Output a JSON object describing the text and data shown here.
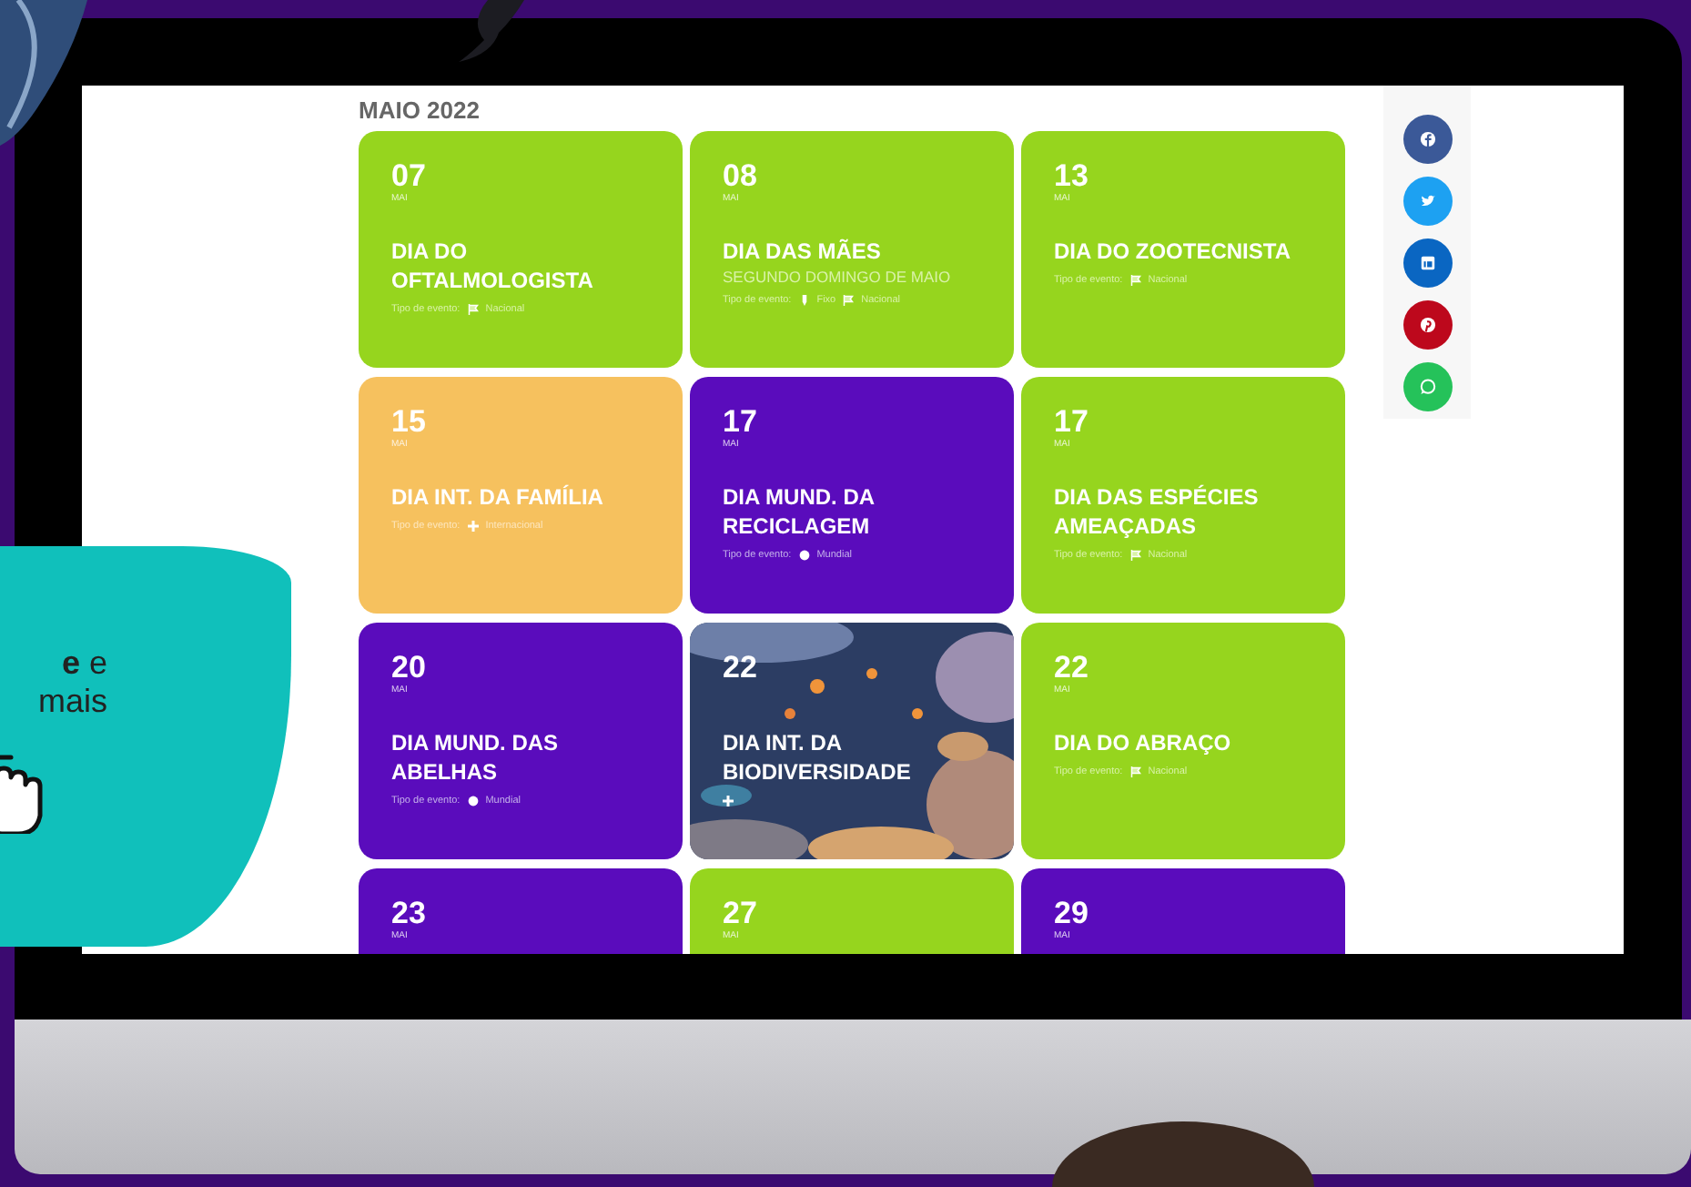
{
  "callout": {
    "lines": [
      "**e** e",
      "mais"
    ]
  },
  "page": {
    "heading": "MAIO 2022",
    "events": [
      {
        "kind": "color",
        "color": "#96d51e",
        "day": "07",
        "month": "MAI",
        "title": "DIA DO OFTALMOLOGISTA",
        "meta_label": "Tipo de evento:",
        "tags": [
          {
            "kind": "nacional",
            "label": "Nacional"
          }
        ]
      },
      {
        "kind": "color",
        "color": "#96d51e",
        "day": "08",
        "month": "MAI",
        "title": "DIA DAS MÃES",
        "subtitle": "SEGUNDO DOMINGO DE MAIO",
        "meta_label": "Tipo de evento:",
        "tags": [
          {
            "kind": "fixo",
            "label": "Fixo"
          },
          {
            "kind": "nacional",
            "label": "Nacional"
          }
        ]
      },
      {
        "kind": "color",
        "color": "#96d51e",
        "day": "13",
        "month": "MAI",
        "title": "DIA DO ZOOTECNISTA",
        "meta_label": "Tipo de evento:",
        "tags": [
          {
            "kind": "nacional",
            "label": "Nacional"
          }
        ]
      },
      {
        "kind": "color",
        "color": "#f6c15e",
        "day": "15",
        "month": "MAI",
        "title": "DIA INT. DA FAMÍLIA",
        "meta_label": "Tipo de evento:",
        "tags": [
          {
            "kind": "internacional",
            "label": "Internacional"
          }
        ]
      },
      {
        "kind": "color",
        "color": "#5a0cbc",
        "day": "17",
        "month": "MAI",
        "title": "DIA MUND. DA RECICLAGEM",
        "meta_label": "Tipo de evento:",
        "tags": [
          {
            "kind": "mundial",
            "label": "Mundial"
          }
        ]
      },
      {
        "kind": "color",
        "color": "#96d51e",
        "day": "17",
        "month": "MAI",
        "title": "DIA DAS ESPÉCIES AMEAÇADAS",
        "meta_label": "Tipo de evento:",
        "tags": [
          {
            "kind": "nacional",
            "label": "Nacional"
          }
        ]
      },
      {
        "kind": "color",
        "color": "#5a0cbc",
        "day": "20",
        "month": "MAI",
        "title": "DIA MUND. DAS ABELHAS",
        "meta_label": "Tipo de evento:",
        "tags": [
          {
            "kind": "mundial",
            "label": "Mundial"
          }
        ]
      },
      {
        "kind": "picture",
        "day": "22",
        "title": "DIA INT. DA BIODIVERSIDADE",
        "tags": [
          {
            "kind": "internacional"
          }
        ]
      },
      {
        "kind": "color",
        "color": "#96d51e",
        "day": "22",
        "month": "MAI",
        "title": "DIA DO ABRAÇO",
        "meta_label": "Tipo de evento:",
        "tags": [
          {
            "kind": "nacional",
            "label": "Nacional"
          }
        ]
      },
      {
        "kind": "color",
        "color": "#5a0cbc",
        "day": "23",
        "month": "MAI"
      },
      {
        "kind": "color",
        "color": "#96d51e",
        "day": "27",
        "month": "MAI"
      },
      {
        "kind": "color",
        "color": "#5a0cbc",
        "day": "29",
        "month": "MAI"
      }
    ],
    "share": [
      {
        "kind": "facebook",
        "color": "#3b5998"
      },
      {
        "kind": "twitter",
        "color": "#1da1f2"
      },
      {
        "kind": "linkedin",
        "color": "#0a66c2"
      },
      {
        "kind": "pinterest",
        "color": "#bd081c"
      },
      {
        "kind": "whatsapp",
        "color": "#25c25a"
      }
    ]
  }
}
